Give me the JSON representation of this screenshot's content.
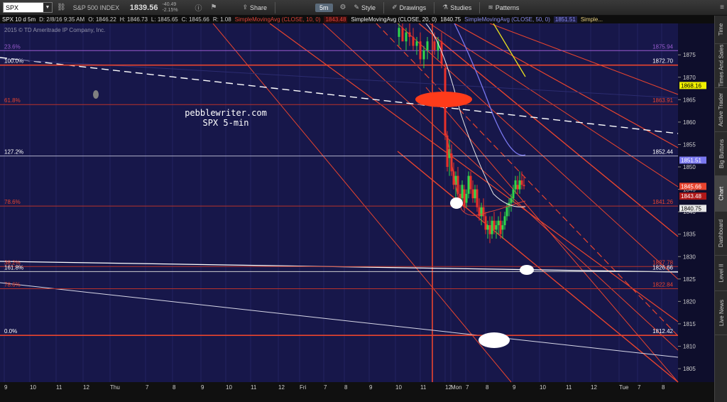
{
  "toolbar": {
    "symbol": "SPX",
    "index_name": "S&P 500 INDEX",
    "last": "1839.56",
    "change": "-40.49",
    "change_pct": "-2.15%",
    "period": "5m",
    "share_label": "Share",
    "style_label": "Style",
    "drawings_label": "Drawings",
    "studies_label": "Studies",
    "patterns_label": "Patterns"
  },
  "infobar": {
    "symbol_period": "SPX 10 d 5m",
    "datetime": "D: 2/8/16 9:35 AM",
    "open": "O: 1846.22",
    "high": "H: 1846.73",
    "low": "L: 1845.65",
    "close": "C: 1845.66",
    "range": "R: 1.08",
    "sma10_label": "SimpleMovingAvg (CLOSE, 10, 0)",
    "sma10_value": "1843.48",
    "sma20_label": "SimpleMovingAvg (CLOSE, 20, 0)",
    "sma20_value": "1840.75",
    "sma50_label": "SimpleMovingAvg (CLOSE, 50, 0)",
    "sma50_value": "1851.51",
    "more_label": "Simple..."
  },
  "copyright": "2015 © TD Ameritrade IP Company, Inc.",
  "annotation": {
    "line1": "pebblewriter.com",
    "line2": "SPX 5-min"
  },
  "side_tabs": [
    "Time",
    "Times And Sales",
    "Active Trader",
    "Big Buttons",
    "Chart",
    "Dashboard",
    "Level II",
    "Live News"
  ],
  "active_tab": "Chart",
  "colors": {
    "background": "#17174a",
    "channel_red": "#e8442e",
    "fib_red": "#b8322a",
    "sma10": "#e0443a",
    "sma20": "#e8e8e8",
    "sma50": "#7a78f0",
    "sma_yellow": "#e8e020",
    "violet": "#9a5cd0",
    "marker_white": "#ffffff",
    "marker_red": "#ff3b1a"
  },
  "chart_data": {
    "type": "candlestick",
    "ylim": [
      1802,
      1882
    ],
    "y_ticks": [
      1805,
      1810,
      1815,
      1820,
      1825,
      1830,
      1835,
      1840,
      1845,
      1850,
      1855,
      1860,
      1865,
      1870,
      1875
    ],
    "x_ticks": [
      "9",
      "10",
      "11",
      "12",
      "Thu",
      "7",
      "8",
      "9",
      "10",
      "11",
      "12",
      "Fri",
      "7",
      "8",
      "9",
      "10",
      "11",
      "12",
      "Mon",
      "7",
      "8",
      "9",
      "10",
      "11",
      "12",
      "Tue",
      "7",
      "8"
    ],
    "fib_levels": [
      {
        "label": "23.6%",
        "value": 1875.94,
        "color": "#9a5cd0",
        "label_color": "#9a5cd0"
      },
      {
        "label": "100.0%",
        "value": 1872.7,
        "color": "#e8442e",
        "label_color": "#ffffff"
      },
      {
        "label": "61.8%",
        "value": 1863.91,
        "color": "#b8322a",
        "label_color": "#e8442e"
      },
      {
        "label": "127.2%",
        "value": 1852.44,
        "color": "#b0b0c8",
        "label_color": "#ffffff"
      },
      {
        "label": "78.6%",
        "value": 1841.26,
        "color": "#b8322a",
        "label_color": "#e8442e"
      },
      {
        "label": "38.2%",
        "value": 1827.78,
        "color": "#b8322a",
        "label_color": "#e8442e"
      },
      {
        "label": "161.8%",
        "value": 1826.66,
        "color": "#d0d0d0",
        "label_color": "#ffffff"
      },
      {
        "label": "78.6%",
        "value": 1822.84,
        "color": "#b8322a",
        "label_color": "#e8442e"
      },
      {
        "label": "0.0%",
        "value": 1812.42,
        "color": "#e8442e",
        "label_color": "#ffffff"
      }
    ],
    "right_labels": [
      {
        "value": "1851.51",
        "bg": "#7a78f0",
        "fg": "#ffffff"
      },
      {
        "value": "1845.66",
        "bg": "#e8442e",
        "fg": "#ffffff"
      },
      {
        "value": "1843.48",
        "bg": "#b01818",
        "fg": "#ffffff"
      },
      {
        "value": "1840.75",
        "bg": "#e8e8e8",
        "fg": "#000000"
      },
      {
        "value": "1868.16",
        "bg": "#f0f000",
        "fg": "#000000"
      }
    ],
    "last_price": 1845.66
  }
}
